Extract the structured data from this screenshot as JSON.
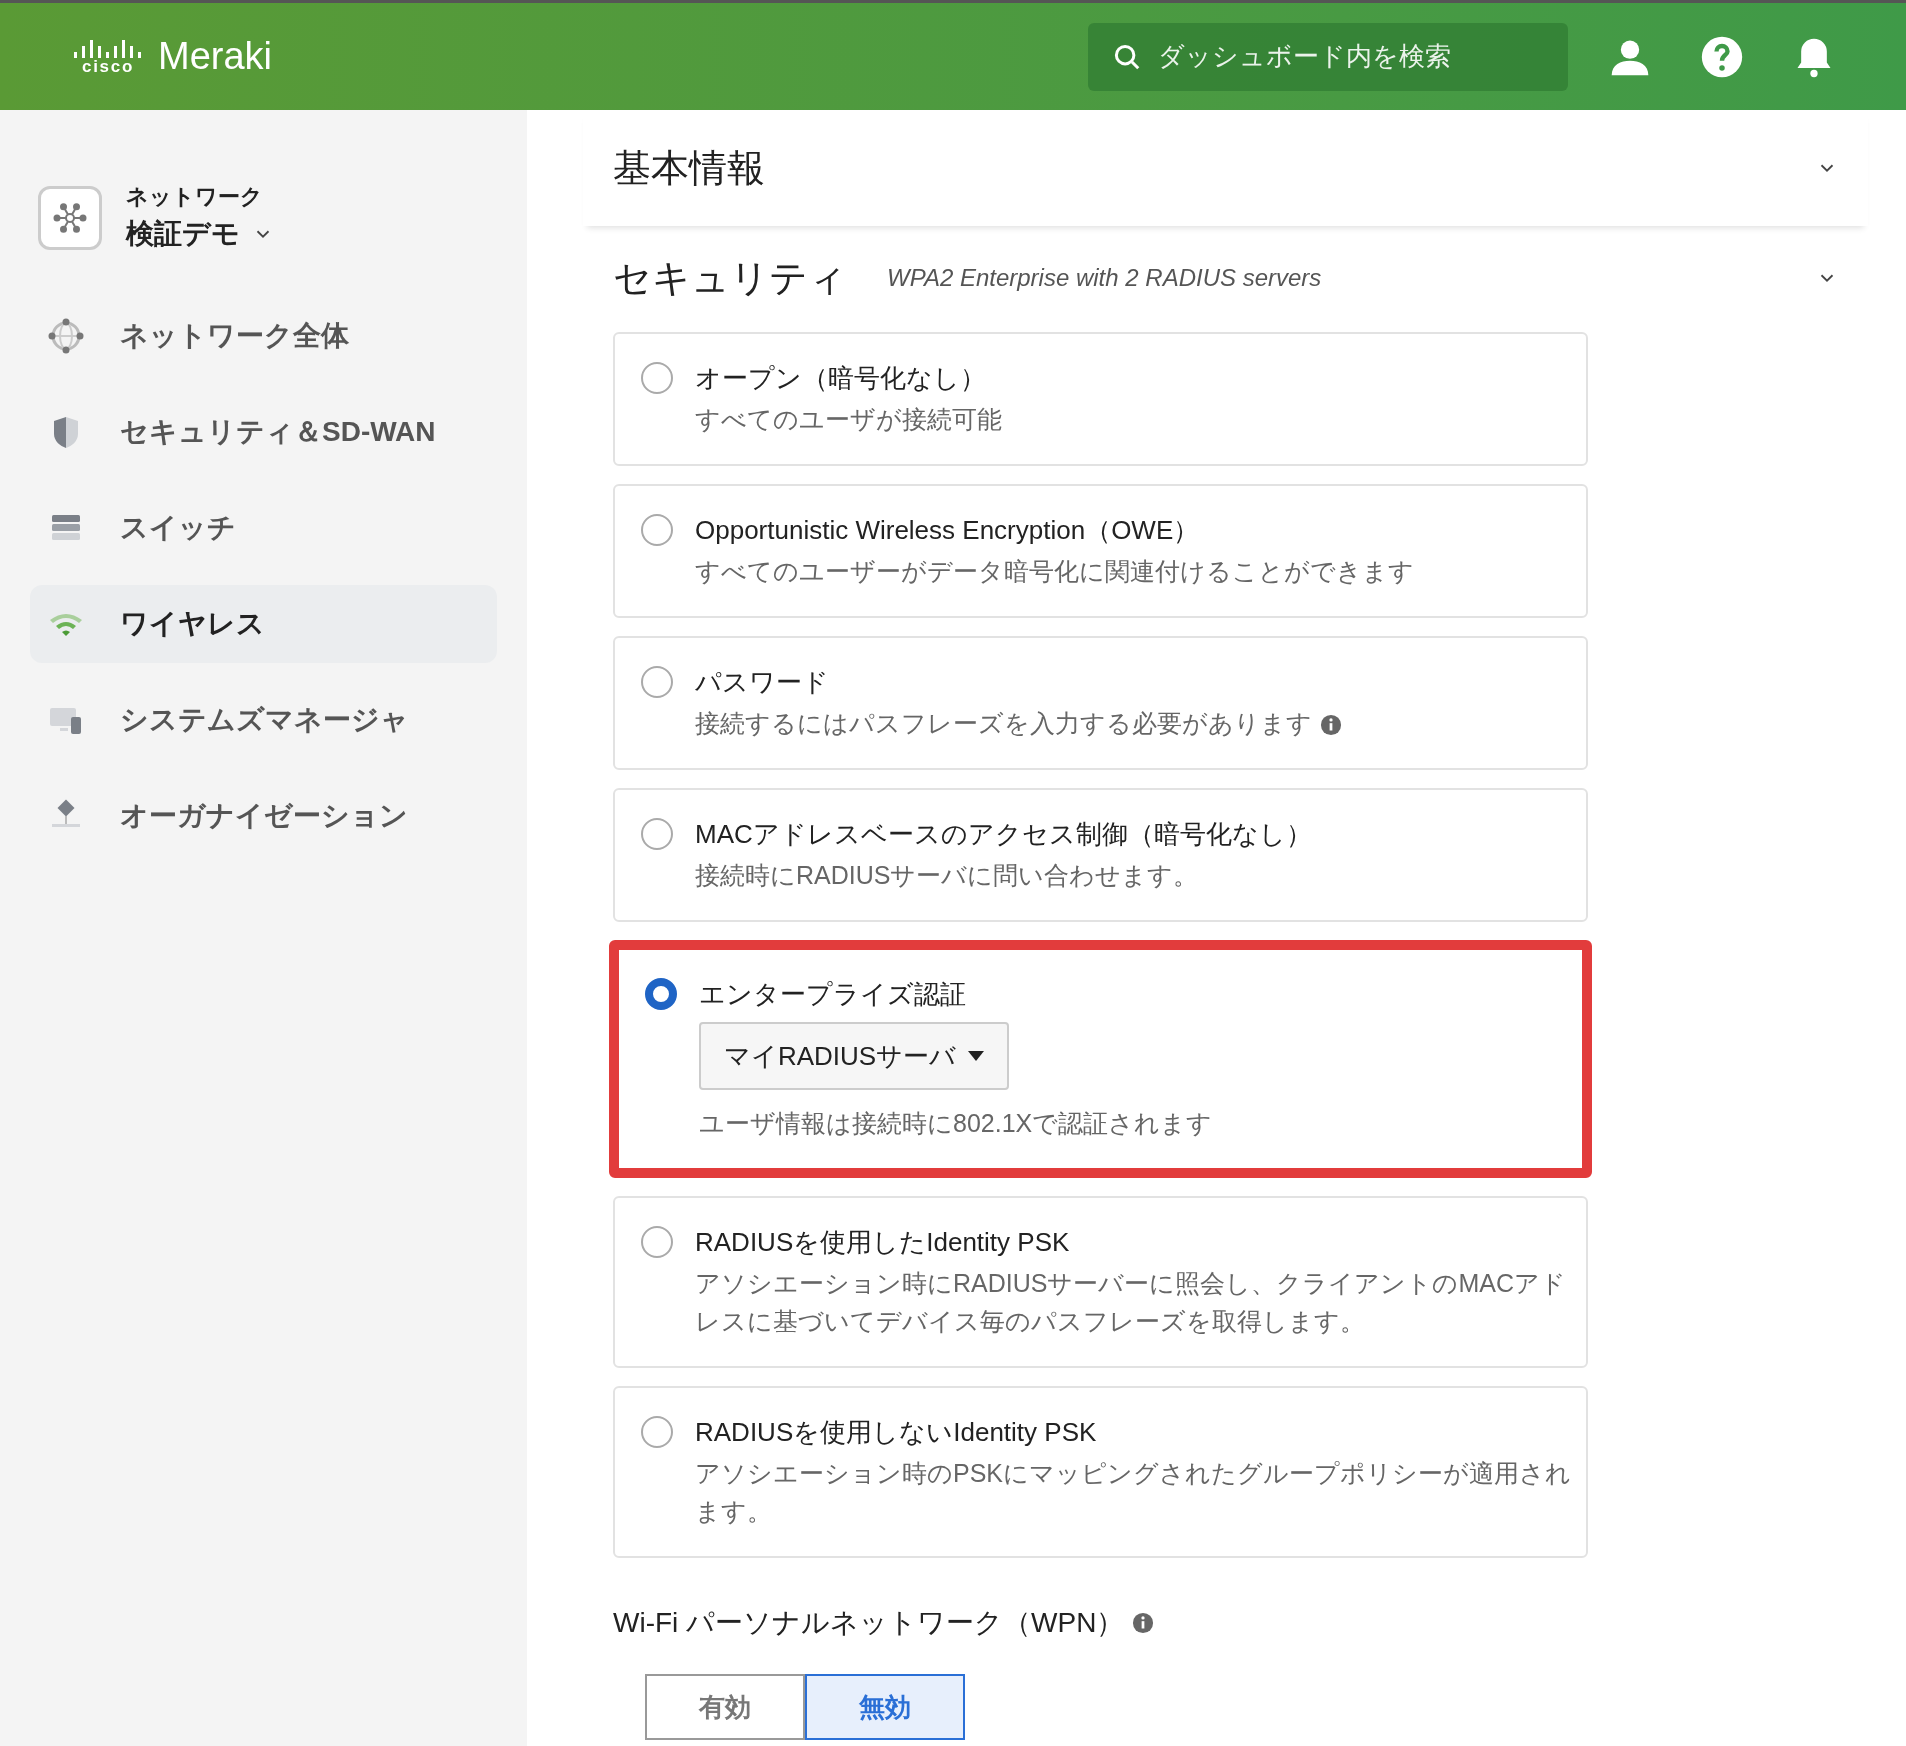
{
  "header": {
    "logo_mark": "cisco",
    "product": "Meraki",
    "search": {
      "placeholder": "ダッシュボード内を検索"
    }
  },
  "sidebar": {
    "network": {
      "label": "ネットワーク",
      "name": "検証デモ"
    },
    "items": [
      {
        "label": "ネットワーク全体",
        "kind": "globe",
        "selected": false
      },
      {
        "label": "セキュリティ＆SD-WAN",
        "kind": "shield",
        "selected": false
      },
      {
        "label": "スイッチ",
        "kind": "switch",
        "selected": false
      },
      {
        "label": "ワイヤレス",
        "kind": "wifi",
        "selected": true
      },
      {
        "label": "システムズマネージャ",
        "kind": "devices",
        "selected": false
      },
      {
        "label": "オーガナイゼーション",
        "kind": "org",
        "selected": false
      }
    ]
  },
  "sections": [
    {
      "title": "基本情報"
    },
    {
      "title": "セキュリティ",
      "summary": "WPA2 Enterprise with 2 RADIUS servers"
    }
  ],
  "options": [
    {
      "title": "オープン（暗号化なし）",
      "description": "すべてのユーザが接続可能",
      "selected": false,
      "highlighted": false,
      "info": false
    },
    {
      "title": "Opportunistic Wireless Encryption（OWE）",
      "description": "すべてのユーザーがデータ暗号化に関連付けることができます",
      "selected": false,
      "highlighted": false,
      "info": false
    },
    {
      "title": "パスワード",
      "description": "接続するにはパスフレーズを入力する必要があります",
      "selected": false,
      "highlighted": false,
      "info": true
    },
    {
      "title": "MACアドレスベースのアクセス制御（暗号化なし）",
      "description": "接続時にRADIUSサーバに問い合わせます。",
      "selected": false,
      "highlighted": false,
      "info": false
    },
    {
      "title": "エンタープライズ認証",
      "dropdown": "マイRADIUSサーバ",
      "description": "ユーザ情報は接続時に802.1Xで認証されます",
      "selected": true,
      "highlighted": true,
      "info": false
    },
    {
      "title": "RADIUSを使用したIdentity PSK",
      "description": "アソシエーション時にRADIUSサーバーに照会し、クライアントのMACアドレスに基づいてデバイス毎のパスフレーズを取得します。",
      "selected": false,
      "highlighted": false,
      "info": false
    },
    {
      "title": "RADIUSを使用しないIdentity PSK",
      "description": "アソシエーション時のPSKにマッピングされたグループポリシーが適用されます。",
      "selected": false,
      "highlighted": false,
      "info": false
    }
  ],
  "wpn": {
    "title": "Wi-Fi パーソナルネットワーク（WPN）",
    "choices": [
      {
        "label": "有効",
        "selected": false
      },
      {
        "label": "無効",
        "selected": true
      }
    ]
  }
}
